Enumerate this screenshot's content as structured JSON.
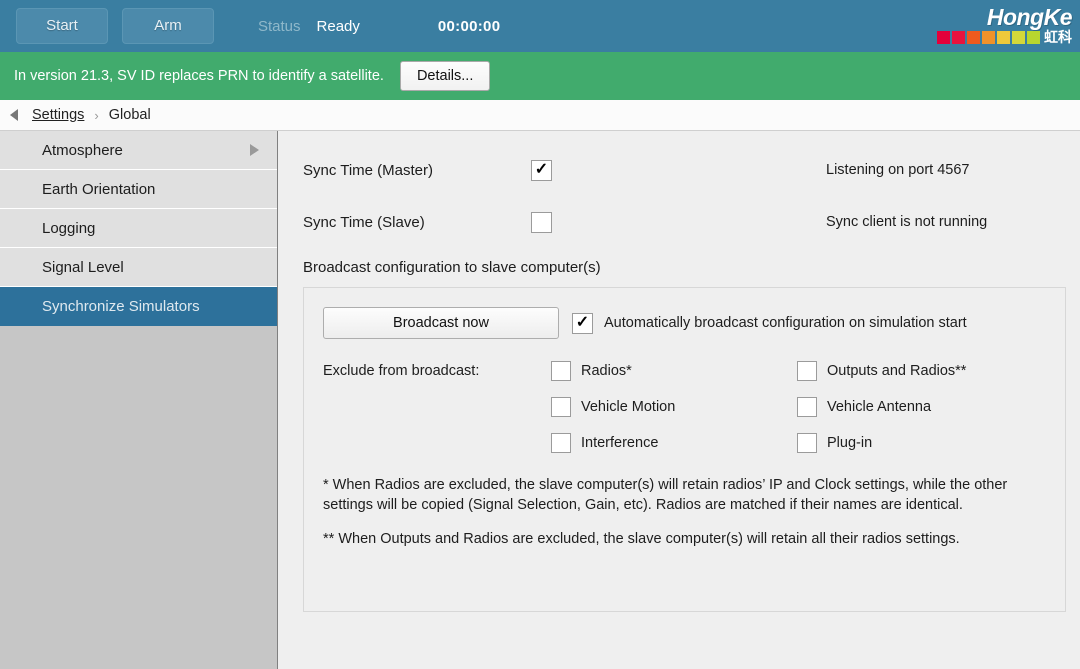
{
  "toolbar": {
    "start_label": "Start",
    "arm_label": "Arm",
    "status_label": "Status",
    "status_value": "Ready",
    "timer": "00:00:00",
    "logo_word": "HongKe",
    "logo_cn": "虹科",
    "logo_colors": [
      "#e4003a",
      "#e8133e",
      "#ee5a1e",
      "#f0922a",
      "#eec93a",
      "#d4d83a",
      "#b8d62e"
    ],
    "accent_bg": "#3a7ea1"
  },
  "banner": {
    "message": "In version 21.3, SV ID replaces PRN to identify a satellite.",
    "button_label": "Details...",
    "bg_color": "#41ab6d"
  },
  "breadcrumb": {
    "back_icon": "triangle-left-icon",
    "root": "Settings",
    "separator": "›",
    "current": "Global"
  },
  "sidebar": {
    "items": [
      {
        "label": "Atmosphere",
        "selected": false,
        "has_submenu": true
      },
      {
        "label": "Earth Orientation",
        "selected": false,
        "has_submenu": false
      },
      {
        "label": "Logging",
        "selected": false,
        "has_submenu": false
      },
      {
        "label": "Signal Level",
        "selected": false,
        "has_submenu": false
      },
      {
        "label": "Synchronize Simulators",
        "selected": true,
        "has_submenu": false
      }
    ],
    "selected_color": "#2d719b"
  },
  "main": {
    "sync_master": {
      "label": "Sync Time (Master)",
      "checked": true,
      "status": "Listening on port 4567"
    },
    "sync_slave": {
      "label": "Sync Time (Slave)",
      "checked": false,
      "status": "Sync client is not running"
    },
    "broadcast": {
      "section_title": "Broadcast configuration to slave computer(s)",
      "broadcast_now_label": "Broadcast now",
      "auto_broadcast_label": "Automatically broadcast configuration on simulation start",
      "auto_broadcast_checked": true,
      "exclude_label": "Exclude from broadcast:",
      "exclude_items": [
        {
          "label": "Radios*",
          "checked": false
        },
        {
          "label": "Outputs and Radios**",
          "checked": false
        },
        {
          "label": "Vehicle Motion",
          "checked": false
        },
        {
          "label": "Vehicle Antenna",
          "checked": false
        },
        {
          "label": "Interference",
          "checked": false
        },
        {
          "label": "Plug-in",
          "checked": false
        }
      ],
      "note_single_star": "* When Radios are excluded, the slave computer(s) will retain radios’ IP and Clock settings, while the other settings will be copied (Signal Selection, Gain, etc). Radios are matched if their names are identical.",
      "note_double_star": "** When Outputs and Radios are excluded, the slave computer(s) will retain all their radios settings."
    }
  },
  "icons": {
    "checkmark": "✓"
  }
}
